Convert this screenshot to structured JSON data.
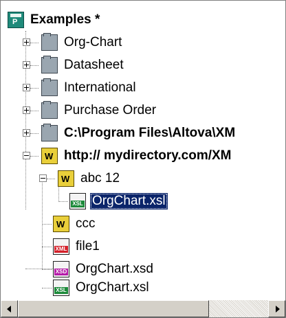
{
  "tree": {
    "root": {
      "label": "Examples *",
      "icon": "project-icon"
    },
    "folders": [
      {
        "label": "Org-Chart",
        "icon": "folder-icon"
      },
      {
        "label": "Datasheet",
        "icon": "folder-icon"
      },
      {
        "label": "International",
        "icon": "folder-icon"
      },
      {
        "label": "Purchase Order",
        "icon": "folder-icon"
      },
      {
        "label": "C:\\Program Files\\Altova\\XM",
        "icon": "folder-icon"
      }
    ],
    "web_folder": {
      "label": "http:// mydirectory.com/XM",
      "icon": "web-folder-icon"
    },
    "subfolder": {
      "label": "abc 12",
      "icon": "web-folder-icon"
    },
    "selected_file": {
      "label": "OrgChart.xsl",
      "icon": "xsl-file-icon",
      "tag": "XSL"
    },
    "items": [
      {
        "label": "ccc",
        "icon": "web-folder-icon"
      },
      {
        "label": "file1",
        "icon": "xml-file-icon",
        "tag": "XML"
      },
      {
        "label": "OrgChart.xsd",
        "icon": "xsd-file-icon",
        "tag": "XSD"
      },
      {
        "label": "OrgChart.xsl",
        "icon": "xsl-file-icon",
        "tag": "XSL"
      }
    ]
  },
  "colors": {
    "selection": "#0a246a",
    "xml_tag": "#d4202a",
    "xsd_tag": "#b51aa8",
    "xsl_tag": "#1c8a3a"
  }
}
